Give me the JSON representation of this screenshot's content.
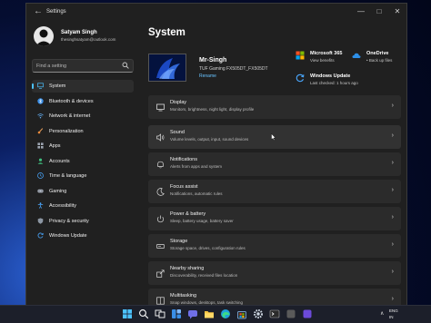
{
  "window": {
    "title": "Settings",
    "back_glyph": "←",
    "min_glyph": "—",
    "max_glyph": "□",
    "close_glyph": "✕"
  },
  "profile": {
    "name": "Satyam Singh",
    "email": "thesinghsatyam@outlook.com"
  },
  "search": {
    "placeholder": "Find a setting"
  },
  "sidebar": {
    "items": [
      {
        "label": "System",
        "icon": "monitor-icon",
        "selected": true
      },
      {
        "label": "Bluetooth & devices",
        "icon": "bluetooth-icon"
      },
      {
        "label": "Network & internet",
        "icon": "wifi-icon"
      },
      {
        "label": "Personalization",
        "icon": "brush-icon"
      },
      {
        "label": "Apps",
        "icon": "apps-icon"
      },
      {
        "label": "Accounts",
        "icon": "person-icon"
      },
      {
        "label": "Time & language",
        "icon": "globe-clock-icon"
      },
      {
        "label": "Gaming",
        "icon": "gamepad-icon"
      },
      {
        "label": "Accessibility",
        "icon": "accessibility-icon"
      },
      {
        "label": "Privacy & security",
        "icon": "shield-icon"
      },
      {
        "label": "Windows Update",
        "icon": "update-icon"
      }
    ]
  },
  "main": {
    "title": "System",
    "device": {
      "name": "Mr-Singh",
      "model": "TUF Gaming FX505DT_FX505DT",
      "rename_label": "Rename"
    },
    "quick": [
      {
        "title": "Microsoft 365",
        "subtitle": "View benefits",
        "icon": "microsoft-365-icon"
      },
      {
        "title": "OneDrive",
        "subtitle": "• Back up files",
        "icon": "onedrive-icon"
      },
      {
        "title": "Windows Update",
        "subtitle": "Last checked: 1 hours ago",
        "icon": "windows-update-icon"
      }
    ],
    "cards": [
      {
        "title": "Display",
        "subtitle": "Monitors, brightness, night light, display profile",
        "icon": "display-icon"
      },
      {
        "title": "Sound",
        "subtitle": "Volume levels, output, input, sound devices",
        "icon": "speaker-icon"
      },
      {
        "title": "Notifications",
        "subtitle": "Alerts from apps and system",
        "icon": "bell-icon"
      },
      {
        "title": "Focus assist",
        "subtitle": "Notifications, automatic rules",
        "icon": "moon-icon"
      },
      {
        "title": "Power & battery",
        "subtitle": "Sleep, battery usage, battery saver",
        "icon": "power-icon"
      },
      {
        "title": "Storage",
        "subtitle": "Storage space, drives, configuration rules",
        "icon": "storage-icon"
      },
      {
        "title": "Nearby sharing",
        "subtitle": "Discoverability, received files location",
        "icon": "share-icon"
      },
      {
        "title": "Multitasking",
        "subtitle": "Snap windows, desktops, task switching",
        "icon": "multitasking-icon"
      }
    ],
    "chevron": "›"
  },
  "taskbar": {
    "icons": [
      "windows-start-icon",
      "search-icon",
      "task-view-icon",
      "widgets-icon",
      "chat-icon",
      "file-explorer-icon",
      "edge-icon",
      "store-icon",
      "settings-icon",
      "terminal-icon",
      "app-icon",
      "app-icon"
    ],
    "tray_caret": "∧",
    "lang_line1": "ENG",
    "lang_line2": "IN"
  },
  "colors": {
    "accent": "#4cc2ff",
    "card_bg": "#2b2b2b",
    "window_bg": "#202020"
  }
}
